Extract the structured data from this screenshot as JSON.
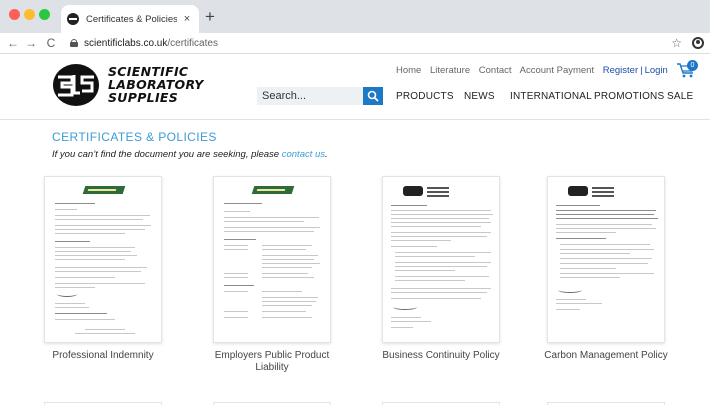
{
  "browser": {
    "tab_title": "Certificates & Policies | (SLS) | ",
    "tab_close": "×",
    "new_tab": "+",
    "url_domain": "scientificlabs.co.uk",
    "url_path": "/certificates",
    "back": "←",
    "forward": "→",
    "reload": "C",
    "bookmark": "☆"
  },
  "brand": {
    "line1": "SCIENTIFIC",
    "line2": "LABORATORY",
    "line3": "SUPPLIES"
  },
  "top_links": {
    "home": "Home",
    "literature": "Literature",
    "contact": "Contact",
    "account_payment": "Account Payment",
    "register": "Register",
    "separator": "|",
    "login": "Login"
  },
  "cart": {
    "count": "0"
  },
  "search": {
    "placeholder": "Search..."
  },
  "nav": {
    "products": "PRODUCTS",
    "news": "NEWS",
    "international": "INTERNATIONAL",
    "promotions": "PROMOTIONS",
    "sale": "SALE"
  },
  "page": {
    "title": "CERTIFICATES & POLICIES",
    "hint_prefix": "If you can’t find the document you are seeking, please",
    "hint_link": "contact us",
    "hint_suffix": "."
  },
  "documents": [
    {
      "label": "Professional Indemnity"
    },
    {
      "label": "Employers Public Product Liability"
    },
    {
      "label": "Business Continuity Policy"
    },
    {
      "label": "Carbon Management Policy"
    }
  ],
  "colors": {
    "accent": "#3d9bd8",
    "nav_blue": "#1d78c5",
    "register": "#1f4ea6"
  }
}
